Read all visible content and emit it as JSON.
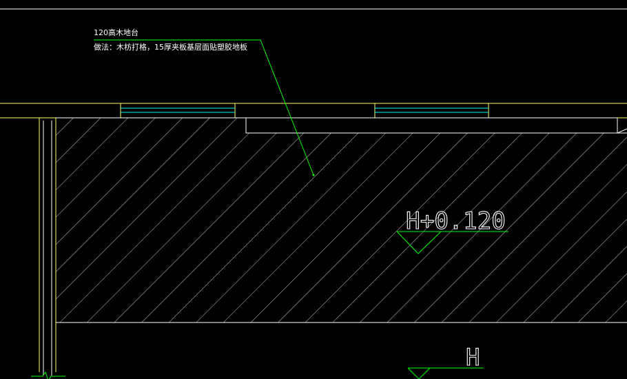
{
  "annotation": {
    "title": "120高木地台",
    "method": "做法：木枋打格，15厚夹板基层面贴塑胶地板"
  },
  "elevations": {
    "platform_label": "H+0.120",
    "floor_label": "H"
  },
  "colors": {
    "background": "#000000",
    "wall_lines": "#ffffff",
    "window_frame": "#ffff66",
    "window_glass": "#00ffff",
    "leader_and_symbols": "#00ff00",
    "hatch": "#ffffff"
  },
  "hatch": {
    "pattern": "diagonal-45"
  }
}
